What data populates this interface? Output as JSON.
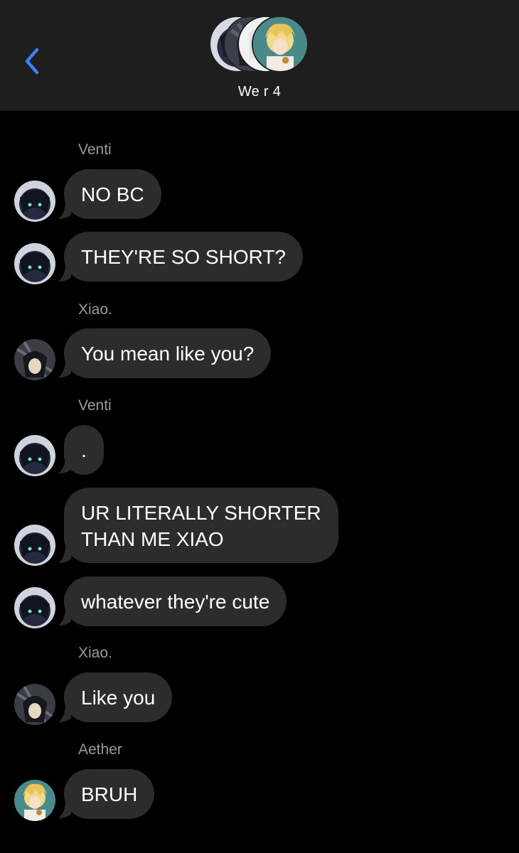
{
  "header": {
    "back_icon": "chevron-left-icon",
    "title": "We r 4",
    "accent": "#3b82f6"
  },
  "messages": [
    {
      "sender": "Venti",
      "text": "NO BC",
      "avatar": "venti"
    },
    {
      "sender": "",
      "text": "THEY'RE SO SHORT?",
      "avatar": "venti"
    },
    {
      "sender": "Xiao.",
      "text": "You mean like you?",
      "avatar": "xiao"
    },
    {
      "sender": "Venti",
      "text": ".",
      "avatar": "venti"
    },
    {
      "sender": "",
      "text": "UR LITERALLY SHORTER\nTHAN ME XIAO",
      "avatar": "venti"
    },
    {
      "sender": "",
      "text": "whatever they're cute",
      "avatar": "venti"
    },
    {
      "sender": "Xiao.",
      "text": "Like you",
      "avatar": "xiao"
    },
    {
      "sender": "Aether",
      "text": "BRUH",
      "avatar": "aether"
    }
  ],
  "colors": {
    "background": "#000000",
    "header": "#1e1e1e",
    "bubble": "#2c2c2e",
    "sender": "#9a9a9f"
  }
}
